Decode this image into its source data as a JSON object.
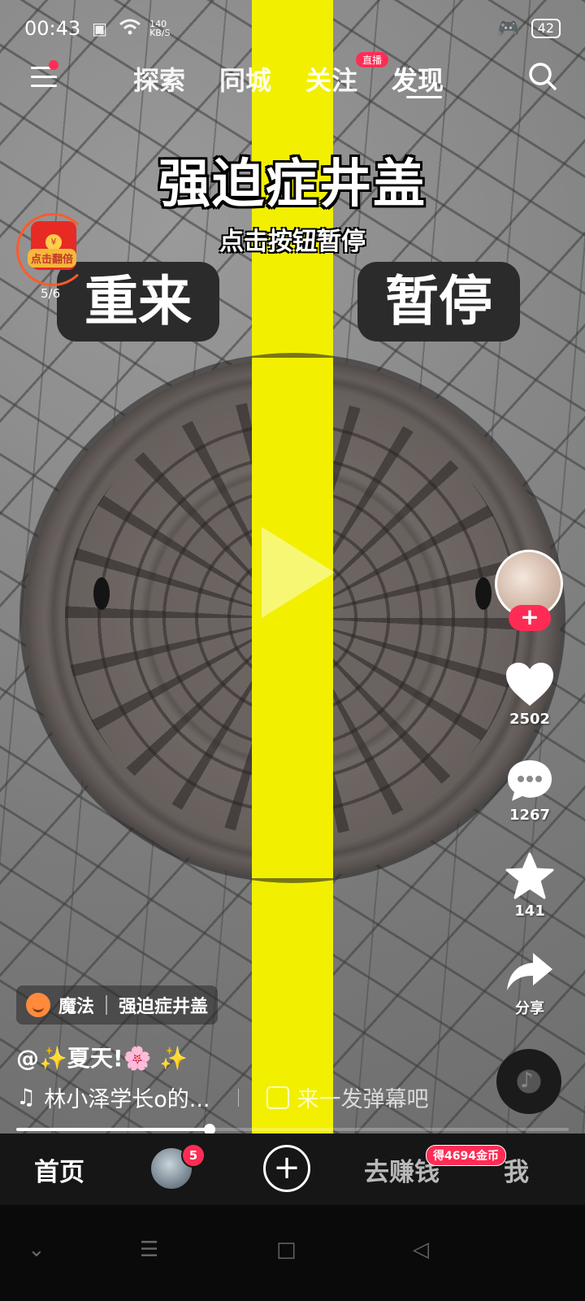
{
  "status_bar": {
    "time": "00:43",
    "speed_value": "140",
    "speed_unit": "KB/S",
    "battery": "42"
  },
  "top_nav": {
    "tabs": [
      {
        "label": "探索"
      },
      {
        "label": "同城"
      },
      {
        "label": "关注"
      },
      {
        "label": "发现"
      }
    ],
    "active_tab": "发现",
    "live_badge": "直播"
  },
  "video": {
    "title": "强迫症井盖",
    "subtitle": "点击按钮暂停",
    "restart_label": "重来",
    "pause_label": "暂停",
    "background_color": "#f2f000"
  },
  "red_packet": {
    "label": "点击翻倍",
    "count": "5/6"
  },
  "side_actions": {
    "follow_symbol": "+",
    "likes": "2502",
    "comments": "1267",
    "favorites": "141",
    "share_label": "分享"
  },
  "info": {
    "effect_label": "魔法",
    "effect_name": "强迫症井盖",
    "author": "@✨夏天!🌸 ✨",
    "music": "林小泽学长o的...",
    "danmaku_placeholder": "来一发弹幕吧"
  },
  "progress": {
    "fraction": 0.35
  },
  "bottom_tabs": {
    "home": "首页",
    "friends_badge": "5",
    "add_symbol": "+",
    "earn": "去赚钱",
    "coin_badge": "得4694金币",
    "me": "我"
  },
  "colors": {
    "accent": "#fe2c55",
    "highlight": "#f2f000"
  }
}
